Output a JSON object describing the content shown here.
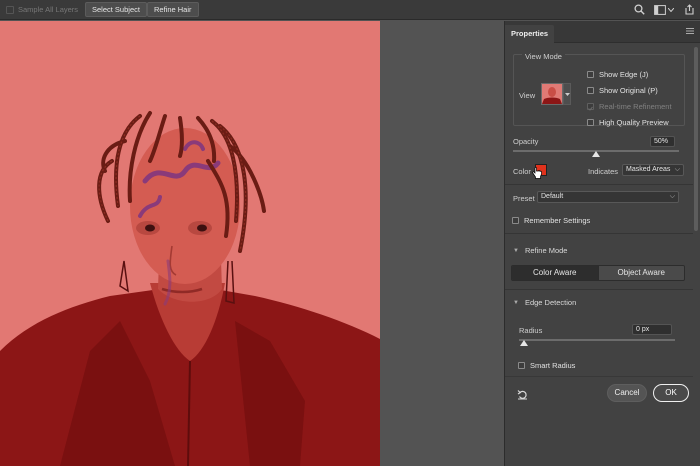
{
  "topbar": {
    "sample_all_layers": "Sample All Layers",
    "select_subject": "Select Subject",
    "refine_hair": "Refine Hair"
  },
  "panel": {
    "tab": "Properties",
    "view_mode": {
      "title": "View Mode",
      "view_label": "View",
      "options": [
        {
          "label": "Show Edge (J)",
          "enabled": true,
          "checked": false
        },
        {
          "label": "Show Original (P)",
          "enabled": true,
          "checked": false
        },
        {
          "label": "Real-time Refinement",
          "enabled": false,
          "checked": true
        },
        {
          "label": "High Quality Preview",
          "enabled": true,
          "checked": false
        }
      ]
    },
    "opacity": {
      "label": "Opacity",
      "value": "50%",
      "level": 0.5
    },
    "color": {
      "label": "Color",
      "swatch": "#e0321c"
    },
    "indicates": {
      "label": "Indicates",
      "value": "Masked Areas"
    },
    "preset": {
      "label": "Preset",
      "value": "Default"
    },
    "remember_settings": "Remember Settings",
    "refine_mode": {
      "title": "Refine Mode",
      "options": [
        "Color Aware",
        "Object Aware"
      ],
      "selected": "Color Aware"
    },
    "edge_detection": {
      "title": "Edge Detection",
      "radius_label": "Radius",
      "radius_value": "0 px",
      "radius_level": 0,
      "smart_radius": "Smart Radius"
    },
    "buttons": {
      "cancel": "Cancel",
      "ok": "OK"
    }
  },
  "colors": {
    "overlay": "#e07470",
    "workspace": "#535353",
    "panel": "#424242"
  }
}
